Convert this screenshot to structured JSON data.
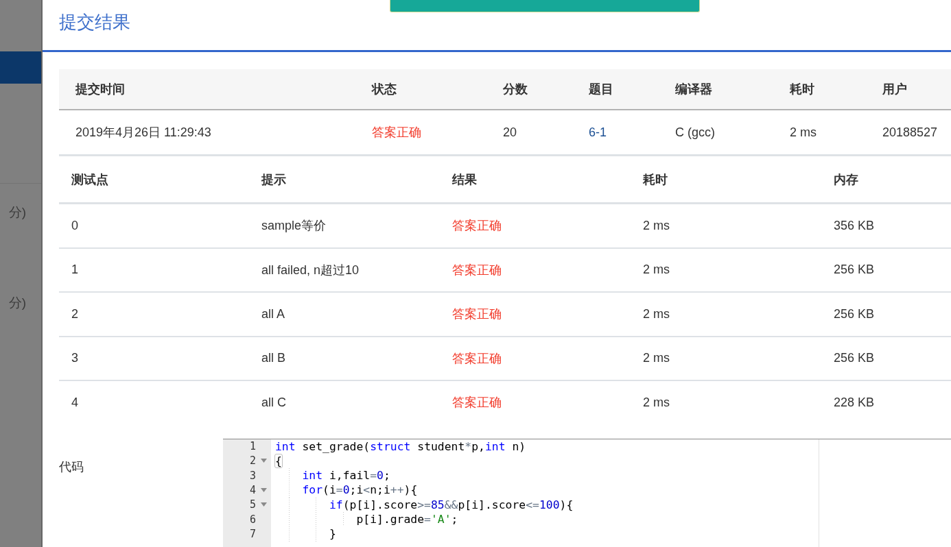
{
  "background_page": {
    "items": [
      {
        "text": "分)"
      },
      {
        "text": "分)"
      }
    ]
  },
  "dialog": {
    "title": "提交结果"
  },
  "submission": {
    "columns": [
      "提交时间",
      "状态",
      "分数",
      "题目",
      "编译器",
      "耗时",
      "用户"
    ],
    "rows": [
      {
        "cells": [
          {
            "text": "2019年4月26日 11:29:43",
            "kind": "text"
          },
          {
            "text": "答案正确",
            "kind": "status"
          },
          {
            "text": "20",
            "kind": "text"
          },
          {
            "text": "6-1",
            "kind": "link"
          },
          {
            "text": "C (gcc)",
            "kind": "text"
          },
          {
            "text": "2 ms",
            "kind": "text"
          },
          {
            "text": "20188527",
            "kind": "text"
          }
        ]
      }
    ]
  },
  "test_cases": {
    "columns": [
      "测试点",
      "提示",
      "结果",
      "耗时",
      "内存"
    ],
    "rows": [
      {
        "cells": [
          {
            "text": "0",
            "kind": "text"
          },
          {
            "text": "sample等价",
            "kind": "text"
          },
          {
            "text": "答案正确",
            "kind": "status"
          },
          {
            "text": "2 ms",
            "kind": "text"
          },
          {
            "text": "356 KB",
            "kind": "text"
          }
        ]
      },
      {
        "cells": [
          {
            "text": "1",
            "kind": "text"
          },
          {
            "text": "all failed, n超过10",
            "kind": "text"
          },
          {
            "text": "答案正确",
            "kind": "status"
          },
          {
            "text": "2 ms",
            "kind": "text"
          },
          {
            "text": "256 KB",
            "kind": "text"
          }
        ]
      },
      {
        "cells": [
          {
            "text": "2",
            "kind": "text"
          },
          {
            "text": "all A",
            "kind": "text"
          },
          {
            "text": "答案正确",
            "kind": "status"
          },
          {
            "text": "2 ms",
            "kind": "text"
          },
          {
            "text": "256 KB",
            "kind": "text"
          }
        ]
      },
      {
        "cells": [
          {
            "text": "3",
            "kind": "text"
          },
          {
            "text": "all B",
            "kind": "text"
          },
          {
            "text": "答案正确",
            "kind": "status"
          },
          {
            "text": "2 ms",
            "kind": "text"
          },
          {
            "text": "256 KB",
            "kind": "text"
          }
        ]
      },
      {
        "cells": [
          {
            "text": "4",
            "kind": "text"
          },
          {
            "text": "all C",
            "kind": "text"
          },
          {
            "text": "答案正确",
            "kind": "status"
          },
          {
            "text": "2 ms",
            "kind": "text"
          },
          {
            "text": "228 KB",
            "kind": "text"
          }
        ]
      }
    ]
  },
  "code": {
    "label": "代码",
    "lines": [
      {
        "number": "1",
        "fold": false,
        "bracket_match": false,
        "tokens": [
          {
            "text": "int",
            "kind": "keyword"
          },
          {
            "text": " set_grade(",
            "kind": "plain"
          },
          {
            "text": "struct",
            "kind": "keyword"
          },
          {
            "text": " student",
            "kind": "plain"
          },
          {
            "text": "*",
            "kind": "operator"
          },
          {
            "text": "p,",
            "kind": "plain"
          },
          {
            "text": "int",
            "kind": "keyword"
          },
          {
            "text": " n)",
            "kind": "plain"
          }
        ]
      },
      {
        "number": "2",
        "fold": true,
        "bracket_match": true,
        "tokens": [
          {
            "text": "{",
            "kind": "plain"
          }
        ]
      },
      {
        "number": "3",
        "fold": false,
        "bracket_match": false,
        "tokens": [
          {
            "text": "    int",
            "kind": "keyword"
          },
          {
            "text": " i,fail",
            "kind": "plain"
          },
          {
            "text": "=",
            "kind": "operator"
          },
          {
            "text": "0",
            "kind": "number"
          },
          {
            "text": ";",
            "kind": "plain"
          }
        ]
      },
      {
        "number": "4",
        "fold": true,
        "bracket_match": false,
        "tokens": [
          {
            "text": "    for",
            "kind": "keyword"
          },
          {
            "text": "(i",
            "kind": "plain"
          },
          {
            "text": "=",
            "kind": "operator"
          },
          {
            "text": "0",
            "kind": "number"
          },
          {
            "text": ";i",
            "kind": "plain"
          },
          {
            "text": "<",
            "kind": "operator"
          },
          {
            "text": "n;i",
            "kind": "plain"
          },
          {
            "text": "++",
            "kind": "operator"
          },
          {
            "text": "){",
            "kind": "plain"
          }
        ]
      },
      {
        "number": "5",
        "fold": true,
        "bracket_match": false,
        "tokens": [
          {
            "text": "        if",
            "kind": "keyword"
          },
          {
            "text": "(p[i].score",
            "kind": "plain"
          },
          {
            "text": ">=",
            "kind": "operator"
          },
          {
            "text": "85",
            "kind": "number"
          },
          {
            "text": "&&",
            "kind": "operator"
          },
          {
            "text": "p[i].score",
            "kind": "plain"
          },
          {
            "text": "<=",
            "kind": "operator"
          },
          {
            "text": "100",
            "kind": "number"
          },
          {
            "text": "){",
            "kind": "plain"
          }
        ]
      },
      {
        "number": "6",
        "fold": false,
        "bracket_match": false,
        "tokens": [
          {
            "text": "            p[i].grade",
            "kind": "plain"
          },
          {
            "text": "=",
            "kind": "operator"
          },
          {
            "text": "'A'",
            "kind": "string"
          },
          {
            "text": ";",
            "kind": "plain"
          }
        ]
      },
      {
        "number": "7",
        "fold": false,
        "bracket_match": false,
        "tokens": [
          {
            "text": "        }",
            "kind": "plain"
          }
        ]
      }
    ]
  }
}
